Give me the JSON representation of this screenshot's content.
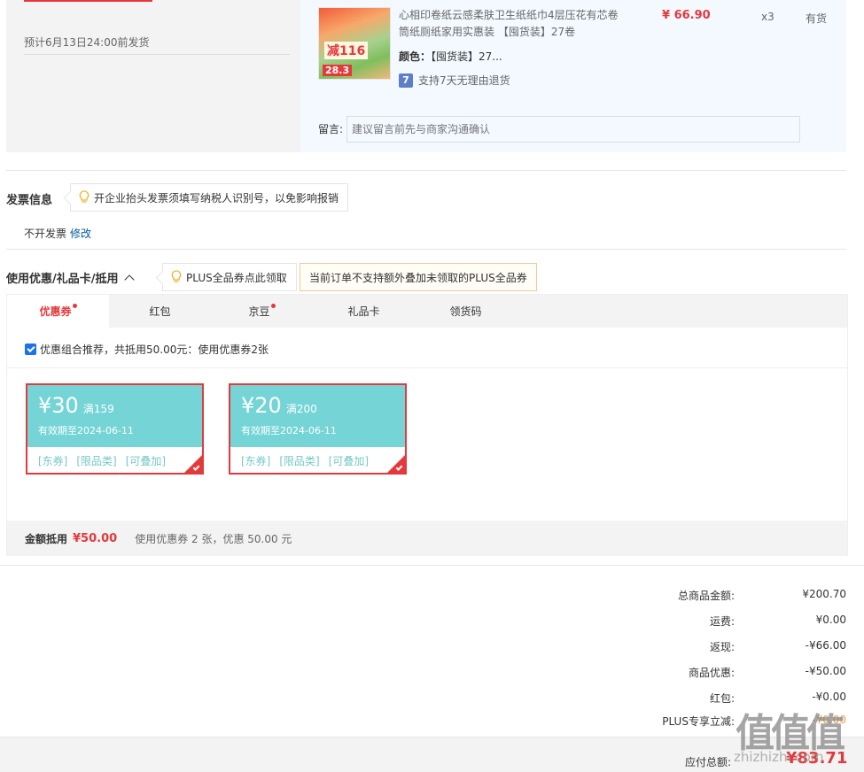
{
  "order": {
    "ship_note": "预计6月13日24:00前发货",
    "product_name": "心相印卷纸云感柔肤卫生纸纸巾4层压花有芯卷筒纸厕纸家用实惠装 【囤货装】27卷",
    "thumb_badge_1": "减116",
    "thumb_badge_2": "28.3",
    "color_label": "颜色：",
    "color_value": "【囤货装】27...",
    "return_icon": "7",
    "return_policy": "支持7天无理由退货",
    "price": "¥ 66.90",
    "quantity": "x3",
    "stock": "有货",
    "message_label": "留言:",
    "message_placeholder": "建议留言前先与商家沟通确认"
  },
  "invoice": {
    "title": "发票信息",
    "tip": "开企业抬头发票须填写纳税人识别号，以免影响报销",
    "status": "不开发票",
    "modify": "修改"
  },
  "coupons": {
    "title": "使用优惠/礼品卡/抵用",
    "plus_tip": "PLUS全品券点此领取",
    "plus_warning": "当前订单不支持额外叠加未领取的PLUS全品券",
    "tabs": [
      {
        "label": "优惠券",
        "dot": true
      },
      {
        "label": "红包",
        "dot": false
      },
      {
        "label": "京豆",
        "dot": true
      },
      {
        "label": "礼品卡",
        "dot": false
      },
      {
        "label": "领货码",
        "dot": false
      }
    ],
    "combo_text": "优惠组合推荐，共抵用50.00元：使用优惠券2张",
    "items": [
      {
        "amount": "¥30",
        "condition": "满159",
        "expiry": "有效期至2024-06-11",
        "tags": [
          "[东券]",
          "[限品类]",
          "[可叠加]"
        ]
      },
      {
        "amount": "¥20",
        "condition": "满200",
        "expiry": "有效期至2024-06-11",
        "tags": [
          "[东券]",
          "[限品类]",
          "[可叠加]"
        ]
      }
    ],
    "deduct_label": "金额抵用",
    "deduct_value": "¥50.00",
    "deduct_desc": "使用优惠券 2 张，优惠 50.00 元"
  },
  "totals": {
    "rows": [
      {
        "label": "总商品金额:",
        "value": "¥200.70"
      },
      {
        "label": "运费:",
        "value": "¥0.00"
      },
      {
        "label": "返现:",
        "value": "-¥66.00"
      },
      {
        "label": "商品优惠:",
        "value": "-¥50.00"
      },
      {
        "label": "红包:",
        "value": "-¥0.00"
      },
      {
        "label": "PLUS专享立减:",
        "value": "-¥0.00"
      }
    ],
    "pay_label": "应付总额:",
    "pay_value": "¥83.71"
  },
  "watermark": {
    "logo": "值值值",
    "text": "zhizhizhi.com"
  },
  "colors": {
    "accent_red": "#e4393c",
    "coupon_teal": "#75d4d6",
    "link_blue": "#005aa0"
  }
}
